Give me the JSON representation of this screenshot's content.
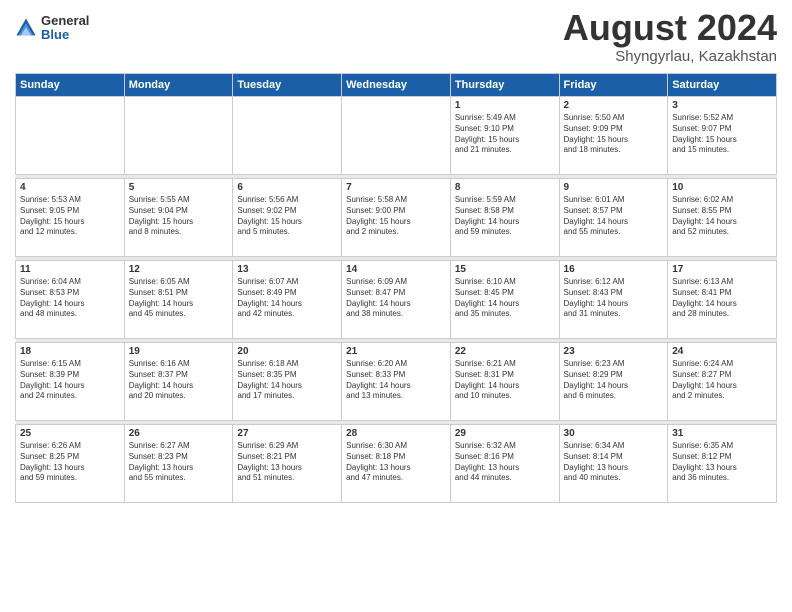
{
  "logo": {
    "general": "General",
    "blue": "Blue"
  },
  "header": {
    "month": "August 2024",
    "location": "Shyngyrlau, Kazakhstan"
  },
  "weekdays": [
    "Sunday",
    "Monday",
    "Tuesday",
    "Wednesday",
    "Thursday",
    "Friday",
    "Saturday"
  ],
  "weeks": [
    [
      {
        "day": "",
        "info": ""
      },
      {
        "day": "",
        "info": ""
      },
      {
        "day": "",
        "info": ""
      },
      {
        "day": "",
        "info": ""
      },
      {
        "day": "1",
        "info": "Sunrise: 5:49 AM\nSunset: 9:10 PM\nDaylight: 15 hours\nand 21 minutes."
      },
      {
        "day": "2",
        "info": "Sunrise: 5:50 AM\nSunset: 9:09 PM\nDaylight: 15 hours\nand 18 minutes."
      },
      {
        "day": "3",
        "info": "Sunrise: 5:52 AM\nSunset: 9:07 PM\nDaylight: 15 hours\nand 15 minutes."
      }
    ],
    [
      {
        "day": "4",
        "info": "Sunrise: 5:53 AM\nSunset: 9:05 PM\nDaylight: 15 hours\nand 12 minutes."
      },
      {
        "day": "5",
        "info": "Sunrise: 5:55 AM\nSunset: 9:04 PM\nDaylight: 15 hours\nand 8 minutes."
      },
      {
        "day": "6",
        "info": "Sunrise: 5:56 AM\nSunset: 9:02 PM\nDaylight: 15 hours\nand 5 minutes."
      },
      {
        "day": "7",
        "info": "Sunrise: 5:58 AM\nSunset: 9:00 PM\nDaylight: 15 hours\nand 2 minutes."
      },
      {
        "day": "8",
        "info": "Sunrise: 5:59 AM\nSunset: 8:58 PM\nDaylight: 14 hours\nand 59 minutes."
      },
      {
        "day": "9",
        "info": "Sunrise: 6:01 AM\nSunset: 8:57 PM\nDaylight: 14 hours\nand 55 minutes."
      },
      {
        "day": "10",
        "info": "Sunrise: 6:02 AM\nSunset: 8:55 PM\nDaylight: 14 hours\nand 52 minutes."
      }
    ],
    [
      {
        "day": "11",
        "info": "Sunrise: 6:04 AM\nSunset: 8:53 PM\nDaylight: 14 hours\nand 48 minutes."
      },
      {
        "day": "12",
        "info": "Sunrise: 6:05 AM\nSunset: 8:51 PM\nDaylight: 14 hours\nand 45 minutes."
      },
      {
        "day": "13",
        "info": "Sunrise: 6:07 AM\nSunset: 8:49 PM\nDaylight: 14 hours\nand 42 minutes."
      },
      {
        "day": "14",
        "info": "Sunrise: 6:09 AM\nSunset: 8:47 PM\nDaylight: 14 hours\nand 38 minutes."
      },
      {
        "day": "15",
        "info": "Sunrise: 6:10 AM\nSunset: 8:45 PM\nDaylight: 14 hours\nand 35 minutes."
      },
      {
        "day": "16",
        "info": "Sunrise: 6:12 AM\nSunset: 8:43 PM\nDaylight: 14 hours\nand 31 minutes."
      },
      {
        "day": "17",
        "info": "Sunrise: 6:13 AM\nSunset: 8:41 PM\nDaylight: 14 hours\nand 28 minutes."
      }
    ],
    [
      {
        "day": "18",
        "info": "Sunrise: 6:15 AM\nSunset: 8:39 PM\nDaylight: 14 hours\nand 24 minutes."
      },
      {
        "day": "19",
        "info": "Sunrise: 6:16 AM\nSunset: 8:37 PM\nDaylight: 14 hours\nand 20 minutes."
      },
      {
        "day": "20",
        "info": "Sunrise: 6:18 AM\nSunset: 8:35 PM\nDaylight: 14 hours\nand 17 minutes."
      },
      {
        "day": "21",
        "info": "Sunrise: 6:20 AM\nSunset: 8:33 PM\nDaylight: 14 hours\nand 13 minutes."
      },
      {
        "day": "22",
        "info": "Sunrise: 6:21 AM\nSunset: 8:31 PM\nDaylight: 14 hours\nand 10 minutes."
      },
      {
        "day": "23",
        "info": "Sunrise: 6:23 AM\nSunset: 8:29 PM\nDaylight: 14 hours\nand 6 minutes."
      },
      {
        "day": "24",
        "info": "Sunrise: 6:24 AM\nSunset: 8:27 PM\nDaylight: 14 hours\nand 2 minutes."
      }
    ],
    [
      {
        "day": "25",
        "info": "Sunrise: 6:26 AM\nSunset: 8:25 PM\nDaylight: 13 hours\nand 59 minutes."
      },
      {
        "day": "26",
        "info": "Sunrise: 6:27 AM\nSunset: 8:23 PM\nDaylight: 13 hours\nand 55 minutes."
      },
      {
        "day": "27",
        "info": "Sunrise: 6:29 AM\nSunset: 8:21 PM\nDaylight: 13 hours\nand 51 minutes."
      },
      {
        "day": "28",
        "info": "Sunrise: 6:30 AM\nSunset: 8:18 PM\nDaylight: 13 hours\nand 47 minutes."
      },
      {
        "day": "29",
        "info": "Sunrise: 6:32 AM\nSunset: 8:16 PM\nDaylight: 13 hours\nand 44 minutes."
      },
      {
        "day": "30",
        "info": "Sunrise: 6:34 AM\nSunset: 8:14 PM\nDaylight: 13 hours\nand 40 minutes."
      },
      {
        "day": "31",
        "info": "Sunrise: 6:35 AM\nSunset: 8:12 PM\nDaylight: 13 hours\nand 36 minutes."
      }
    ]
  ]
}
